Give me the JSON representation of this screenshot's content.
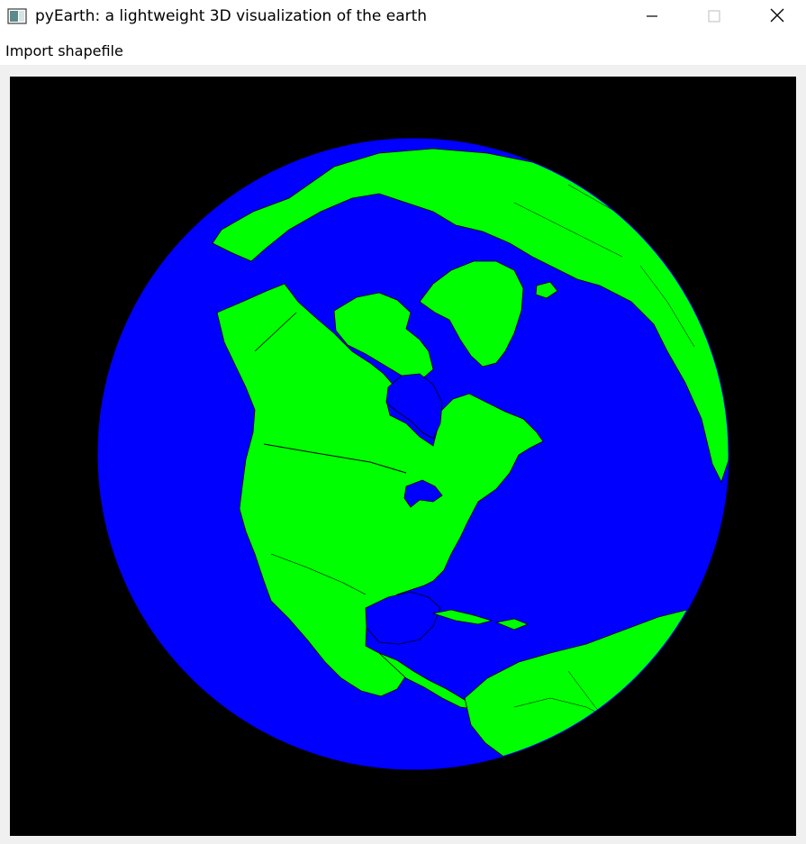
{
  "window": {
    "title": "pyEarth: a lightweight 3D visualization of the earth",
    "icon": "app-window-icon",
    "controls": {
      "minimize_icon": "minimize-icon",
      "maximize_icon": "maximize-icon",
      "close_icon": "close-icon"
    }
  },
  "menubar": {
    "items": [
      {
        "label": "Import shapefile"
      }
    ]
  },
  "viewport": {
    "background_color": "#000000",
    "ocean_color": "#0000ff",
    "land_color": "#00ff00",
    "border_color": "#000000",
    "content": "earth-globe"
  }
}
